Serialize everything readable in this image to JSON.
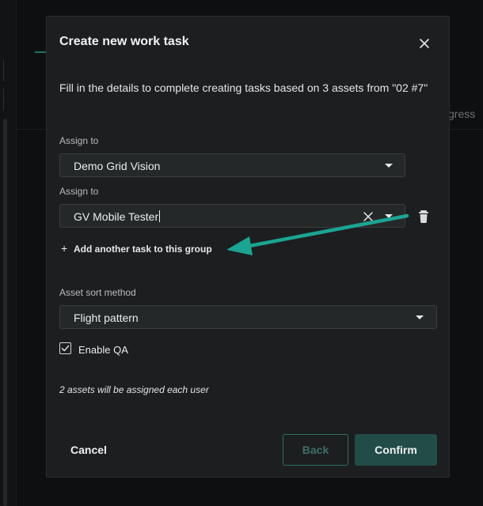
{
  "background": {
    "progress_partial": "gress"
  },
  "modal": {
    "title": "Create new work task",
    "description": "Fill in the details to complete creating tasks based on 3 assets from \"02 #7\"",
    "tasks": [
      {
        "label": "Assign to",
        "value": "Demo Grid Vision"
      },
      {
        "label": "Assign to",
        "value": "GV Mobile Tester"
      }
    ],
    "add_task_label": "Add another task to this group",
    "sort": {
      "label": "Asset sort method",
      "value": "Flight pattern"
    },
    "qa": {
      "label": "Enable QA",
      "checked": true
    },
    "assign_note": "2 assets will be assigned each user",
    "buttons": {
      "cancel": "Cancel",
      "back": "Back",
      "confirm": "Confirm"
    }
  },
  "colors": {
    "accent_arrow": "#1aa592",
    "confirm_bg": "#224c48",
    "back_border": "#2c6f68"
  },
  "icons": [
    "close-icon",
    "chevron-down-icon",
    "clear-icon",
    "trash-icon",
    "plus-icon",
    "checkmark-icon",
    "annotation-arrow"
  ]
}
